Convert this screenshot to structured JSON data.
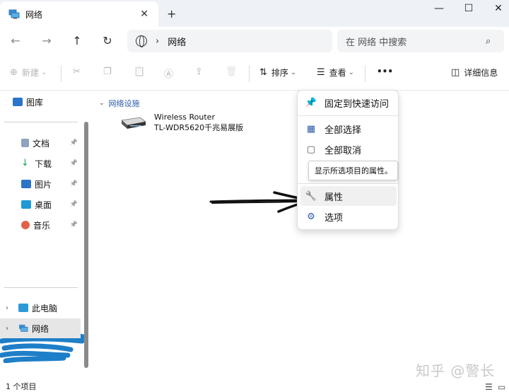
{
  "window": {
    "tab_title": "网络",
    "tab_close": "✕",
    "new_tab": "+",
    "minimize": "—",
    "maximize": "☐",
    "close": "✕"
  },
  "nav": {
    "back": "←",
    "forward": "→",
    "up": "↑",
    "refresh": "↻",
    "breadcrumb_sep": "›",
    "breadcrumb": "网络",
    "search_placeholder": "在 网络 中搜索",
    "search_icon": "⌕"
  },
  "toolbar": {
    "new_label": "新建",
    "new_icon": "⊕",
    "cut_icon": "✂",
    "copy_icon": "❐",
    "paste_icon": "📋",
    "rename_icon": "Ⓐ",
    "share_icon": "⇪",
    "delete_icon": "🗑",
    "sort_label": "排序",
    "sort_icon": "⇅",
    "view_label": "查看",
    "view_icon": "☰",
    "more_label": "•••",
    "details_label": "详细信息",
    "details_icon": "◫",
    "chevron": "⌄"
  },
  "sidebar": {
    "items": [
      {
        "label": "图库",
        "pinned": false
      },
      {
        "label": "文档",
        "pinned": true
      },
      {
        "label": "下载",
        "pinned": true
      },
      {
        "label": "图片",
        "pinned": true
      },
      {
        "label": "桌面",
        "pinned": true
      },
      {
        "label": "音乐",
        "pinned": true
      },
      {
        "label": "此电脑",
        "pinned": false
      },
      {
        "label": "网络",
        "pinned": false
      }
    ],
    "pin_glyph": "📌",
    "expand_glyph": "›"
  },
  "content": {
    "group_title": "网络设施",
    "group_chevron": "⌄",
    "device_name": "Wireless Router",
    "device_model": "TL-WDR5620千兆易展版"
  },
  "context_menu": {
    "items": [
      {
        "label": "固定到快速访问",
        "icon": "📌"
      },
      {
        "label": "全部选择",
        "icon": "▦"
      },
      {
        "label": "全部取消",
        "icon": "▢"
      },
      {
        "label": "属性",
        "icon": "🔧"
      },
      {
        "label": "选项",
        "icon": "⚙"
      }
    ],
    "tooltip": "显示所选项目的属性。"
  },
  "status": {
    "item_count": "1 个项目",
    "watermark": "知乎 @警长"
  },
  "colors": {
    "accent": "#2a5aa8",
    "scribble": "#1e7fc8",
    "titlebar": "#eef1f6"
  }
}
